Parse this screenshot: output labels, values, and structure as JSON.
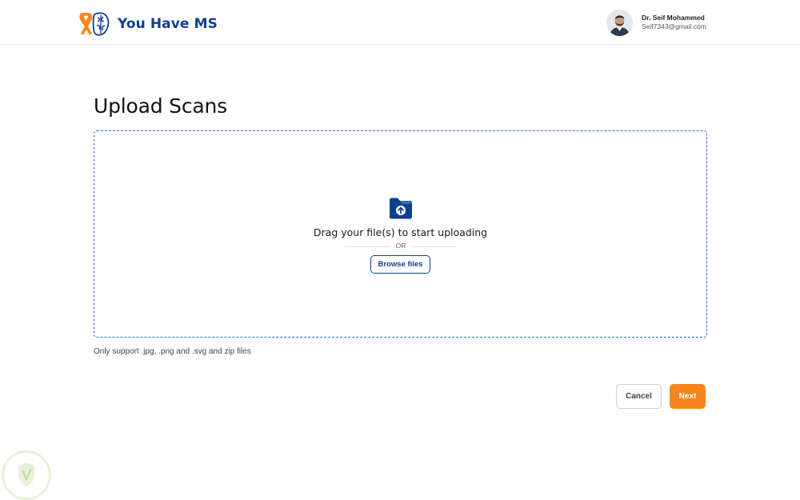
{
  "header": {
    "app_name": "You Have MS",
    "logo_icon": "ribbon-brain-icon",
    "user": {
      "name": "Dr. Seif Mohammed",
      "email": "Seif7343@gmail.com",
      "avatar_icon": "user-avatar"
    }
  },
  "main": {
    "title": "Upload Scans",
    "dropzone": {
      "icon": "folder-upload-icon",
      "instruction": "Drag your file(s) to start uploading",
      "separator": "OR",
      "browse_label": "Browse files"
    },
    "support_note": "Only support .jpg, .png and .svg and zip files"
  },
  "actions": {
    "cancel_label": "Cancel",
    "next_label": "Next"
  },
  "colors": {
    "brand_blue": "#0f3f8f",
    "accent_orange": "#f7861e",
    "dropzone_border": "#2f6db5"
  }
}
